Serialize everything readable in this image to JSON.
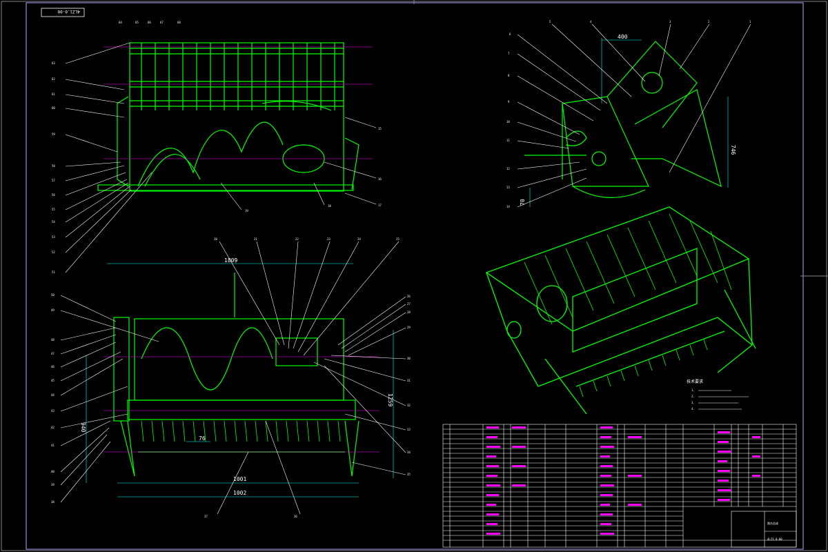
{
  "drawing": {
    "code_top": "4LZ1.0-00",
    "code_bottom": "4LZ1.0-00",
    "title_block_name": "割台总成",
    "colors": {
      "background": "#000000",
      "structure": "#00ff00",
      "leader": "#ffffff",
      "centerline": "#ff00ff",
      "dimension": "#00ffff"
    }
  },
  "front_view": {
    "labels_left": [
      "63",
      "62",
      "61",
      "60",
      "59",
      "58",
      "57",
      "56",
      "55",
      "54",
      "53",
      "52",
      "51"
    ],
    "labels_top": [
      "64",
      "65",
      "66",
      "67",
      "68"
    ],
    "labels_right": [
      "15",
      "16",
      "17",
      "18",
      "19"
    ]
  },
  "side_view": {
    "dim_top": "400",
    "dim_right": "746",
    "dim_bottom": "70",
    "labels_top": [
      "6",
      "5",
      "4",
      "3",
      "2",
      "1"
    ],
    "labels_left": [
      "7",
      "8",
      "9",
      "10",
      "11",
      "12",
      "13",
      "14"
    ]
  },
  "top_view": {
    "dim_top": "1809",
    "dim_left": "940",
    "dim_right": "1259",
    "dim_pitch": "76",
    "dim_bottom_a": "1001",
    "dim_bottom_b": "1002",
    "labels_top": [
      "20",
      "21",
      "22",
      "23",
      "24",
      "25"
    ],
    "labels_left": [
      "50",
      "49",
      "48",
      "47",
      "46",
      "45",
      "44",
      "43",
      "42",
      "41",
      "40",
      "39",
      "38"
    ],
    "labels_right": [
      "26",
      "27",
      "28",
      "29",
      "30",
      "31",
      "32",
      "33",
      "34",
      "35"
    ],
    "labels_bottom": [
      "37",
      "36"
    ]
  },
  "tech_requirements": {
    "title": "技术要求",
    "items": [
      "1.",
      "2.",
      "3.",
      "4."
    ]
  }
}
